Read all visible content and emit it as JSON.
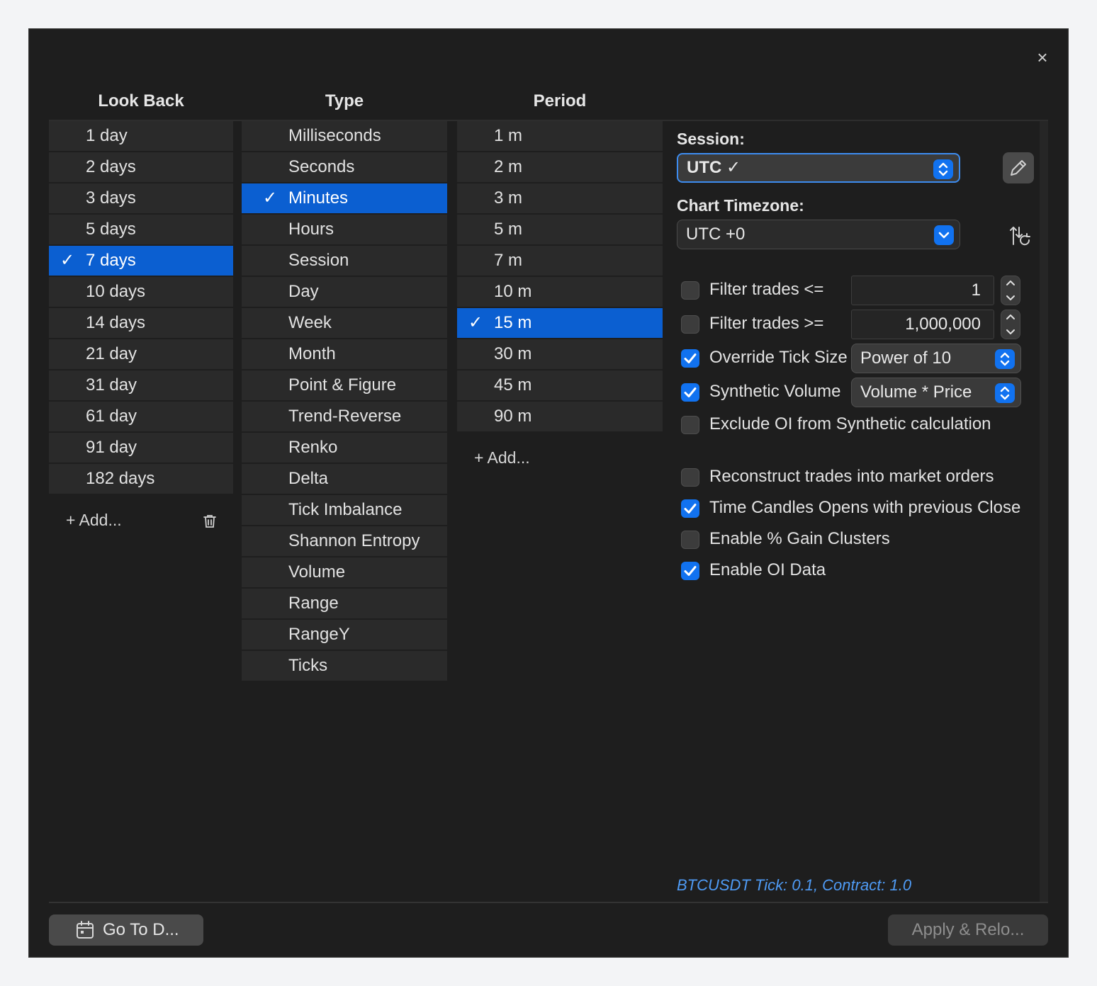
{
  "dialog": {
    "close_glyph": "×"
  },
  "columns": {
    "lookback": "Look Back",
    "type": "Type",
    "period": "Period"
  },
  "lookback": {
    "items": [
      "1 day",
      "2 days",
      "3 days",
      "5 days",
      "7 days",
      "10 days",
      "14 days",
      "21 day",
      "31 day",
      "61 day",
      "91 day",
      "182 days"
    ],
    "selected": "7 days",
    "add_label": "+ Add..."
  },
  "type": {
    "items": [
      "Milliseconds",
      "Seconds",
      "Minutes",
      "Hours",
      "Session",
      "Day",
      "Week",
      "Month",
      "Point & Figure",
      "Trend-Reverse",
      "Renko",
      "Delta",
      "Tick Imbalance",
      "Shannon Entropy",
      "Volume",
      "Range",
      "RangeY",
      "Ticks"
    ],
    "selected": "Minutes"
  },
  "period": {
    "items": [
      "1 m",
      "2 m",
      "3 m",
      "5 m",
      "7 m",
      "10 m",
      "15 m",
      "30 m",
      "45 m",
      "90 m"
    ],
    "selected": "15 m",
    "add_label": "+ Add..."
  },
  "check_glyph": "✓",
  "settings": {
    "session_label": "Session:",
    "session_value": "UTC ✓",
    "timezone_label": "Chart Timezone:",
    "timezone_value": "UTC +0",
    "filter_le_label": "Filter trades <=",
    "filter_le_value": "1",
    "filter_ge_label": "Filter trades >=",
    "filter_ge_value": "1,000,000",
    "override_tick_label": "Override Tick Size",
    "override_tick_value": "Power of 10",
    "synthetic_volume_label": "Synthetic Volume",
    "synthetic_volume_value": "Volume * Price",
    "exclude_oi_label": "Exclude OI from Synthetic calculation",
    "reconstruct_label": "Reconstruct trades into market orders",
    "time_candles_label": "Time Candles Opens with previous Close",
    "gain_clusters_label": "Enable % Gain Clusters",
    "oi_data_label": "Enable OI Data",
    "checked": {
      "filter_le": false,
      "filter_ge": false,
      "override_tick": true,
      "synthetic_volume": true,
      "exclude_oi": false,
      "reconstruct": false,
      "time_candles": true,
      "gain_clusters": false,
      "oi_data": true
    },
    "info_text": "BTCUSDT Tick: 0.1, Contract: 1.0"
  },
  "footer": {
    "goto_label": "Go To D...",
    "apply_label": "Apply & Relo..."
  },
  "colors": {
    "accent": "#1172f0",
    "selection": "#0b5fd1",
    "info": "#4f9bf5"
  }
}
